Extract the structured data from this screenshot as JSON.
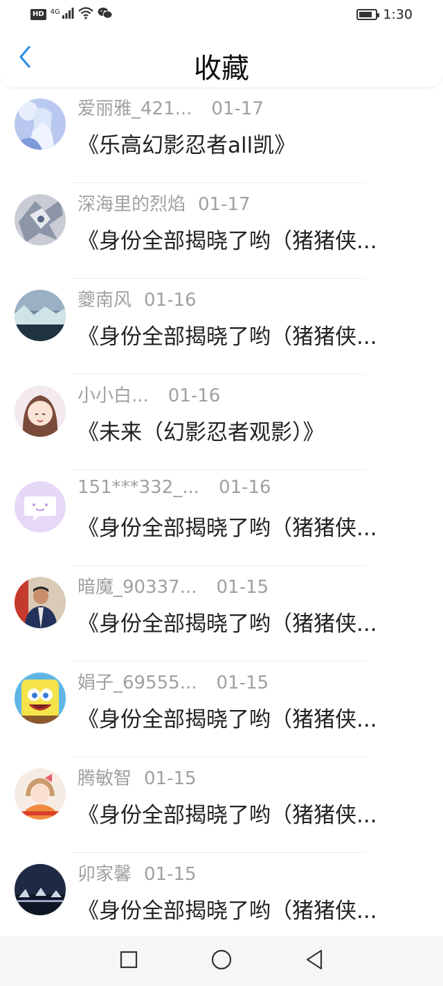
{
  "status_bar": {
    "network_badge": "HD",
    "network_type": "4G",
    "time": "1:30",
    "battery_level": 0.8,
    "icons": [
      "signal-icon",
      "wifi-icon",
      "wechat-icon",
      "battery-icon"
    ]
  },
  "header": {
    "title": "收藏",
    "back_icon": "chevron-left-icon",
    "accent_color": "#2b8ee8"
  },
  "favorites": [
    {
      "user": "爱丽雅_421...",
      "date": "01-17",
      "book": "《乐高幻影忍者all凯》",
      "avatar": "anime-ice-princess"
    },
    {
      "user": "深海里的烈焰",
      "date": "01-17",
      "book": "《身份全部揭晓了哟（猪猪侠...",
      "avatar": "mecha-robot"
    },
    {
      "user": "夔南风",
      "date": "01-16",
      "book": "《身份全部揭晓了哟（猪猪侠...",
      "avatar": "icy-landscape"
    },
    {
      "user": "小小白...",
      "date": "01-16",
      "book": "《未来（幻影忍者观影）》",
      "avatar": "anime-girl-brown-hair"
    },
    {
      "user": "151***332_...",
      "date": "01-16",
      "book": "《身份全部揭晓了哟（猪猪侠...",
      "avatar": "default-chat-bubble"
    },
    {
      "user": "暗魔_90337...",
      "date": "01-15",
      "book": "《身份全部揭晓了哟（猪猪侠...",
      "avatar": "man-in-jacket"
    },
    {
      "user": "娟子_69555...",
      "date": "01-15",
      "book": "《身份全部揭晓了哟（猪猪侠...",
      "avatar": "spongebob"
    },
    {
      "user": "腾敏智",
      "date": "01-15",
      "book": "《身份全部揭晓了哟（猪猪侠...",
      "avatar": "girl-with-bow"
    },
    {
      "user": "卯家馨",
      "date": "01-15",
      "book": "《身份全部揭晓了哟（猪猪侠...",
      "avatar": "night-scene"
    }
  ],
  "nav_bar": {
    "buttons": [
      "recent-apps-icon",
      "home-icon",
      "back-icon"
    ]
  }
}
